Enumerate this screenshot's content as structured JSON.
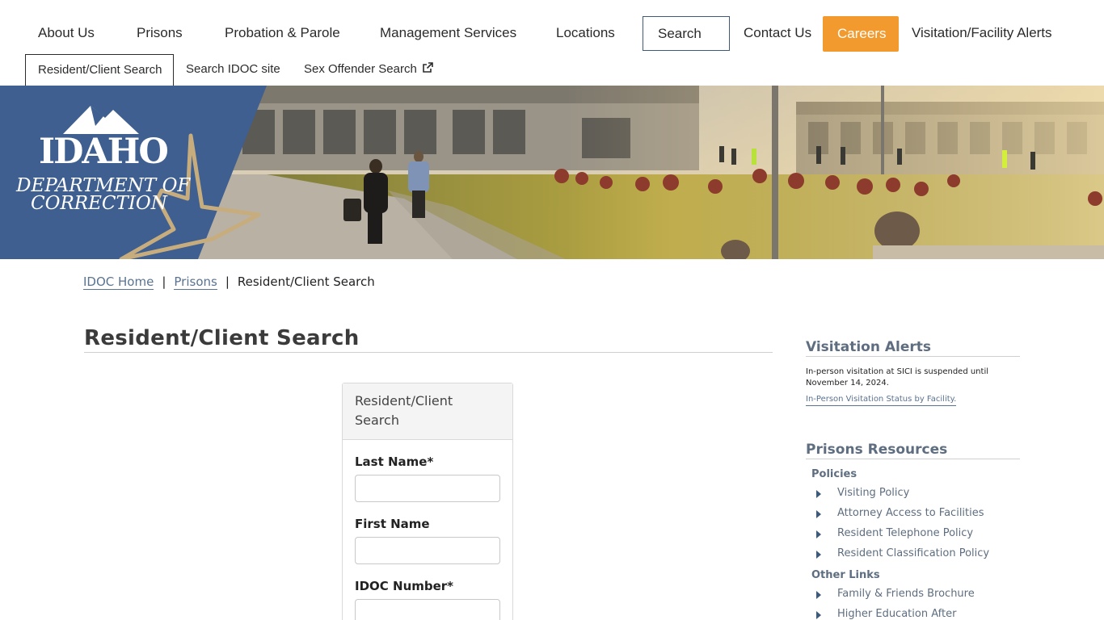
{
  "main_nav": [
    {
      "label": "About Us"
    },
    {
      "label": "Prisons"
    },
    {
      "label": "Probation & Parole"
    },
    {
      "label": "Management Services"
    },
    {
      "label": "Locations"
    },
    {
      "label": "Search"
    },
    {
      "label": "Contact Us"
    },
    {
      "label": "Careers"
    },
    {
      "label": "Visitation/Facility Alerts"
    }
  ],
  "sub_nav": [
    {
      "label": "Resident/Client Search"
    },
    {
      "label": "Search IDOC site"
    },
    {
      "label": "Sex Offender Search"
    }
  ],
  "logo": {
    "line1": "IDAHO",
    "line2": "DEPARTMENT OF",
    "line3": "CORRECTION"
  },
  "breadcrumb": {
    "home": "IDOC Home",
    "section": "Prisons",
    "current": "Resident/Client Search",
    "separator": "|"
  },
  "page_title": "Resident/Client Search",
  "form": {
    "header": "Resident/Client Search",
    "fields": [
      {
        "label": "Last Name*",
        "value": ""
      },
      {
        "label": "First Name",
        "value": ""
      },
      {
        "label": "IDOC Number*",
        "value": ""
      }
    ]
  },
  "sidebar": {
    "alerts_heading": "Visitation Alerts",
    "alert_text": "In-person visitation at SICI is suspended until November 14, 2024.",
    "alert_link": "In-Person Visitation Status by Facility.",
    "resources_heading": "Prisons Resources",
    "groups": [
      {
        "name": "Policies",
        "links": [
          "Visiting Policy",
          "Attorney Access to Facilities",
          "Resident Telephone Policy",
          "Resident Classification Policy"
        ]
      },
      {
        "name": "Other Links",
        "links": [
          "Family & Friends Brochure",
          "Higher Education After"
        ]
      }
    ]
  },
  "colors": {
    "accent": "#f29a2e",
    "navy": "#3d5a7a",
    "logo_blue": "#3e5f8f",
    "logo_gold": "#c7ad7e",
    "link": "#5a7391"
  }
}
